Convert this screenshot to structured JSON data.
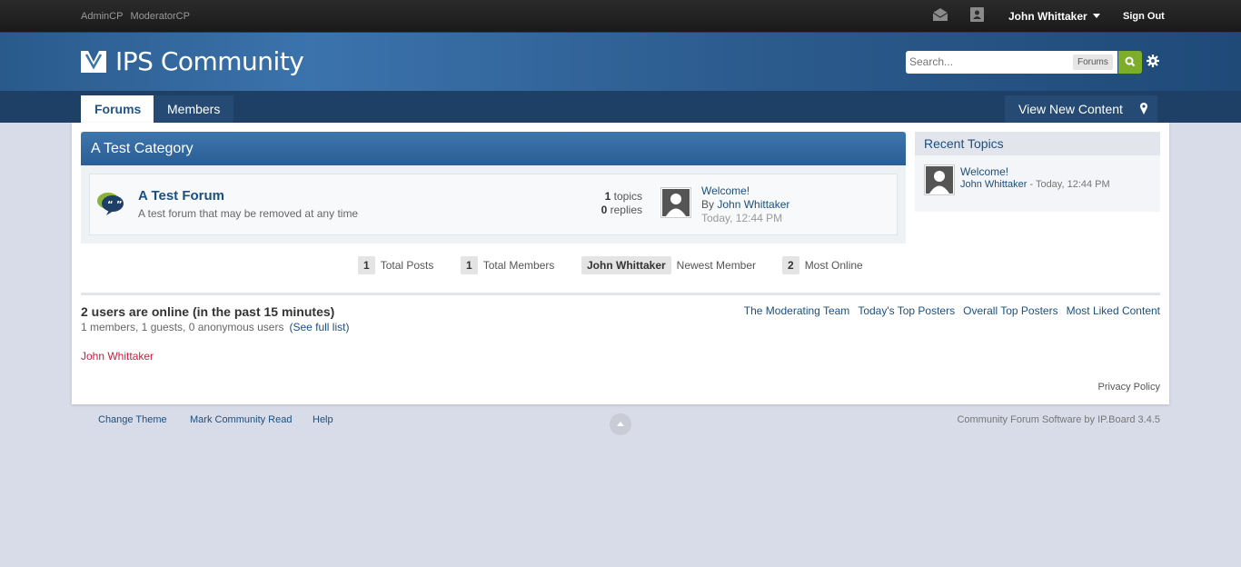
{
  "topbar": {
    "admin_links": [
      "AdminCP",
      "ModeratorCP"
    ],
    "user_name": "John Whittaker",
    "sign_out": "Sign Out",
    "icons": [
      "envelope-icon",
      "notifications-icon"
    ]
  },
  "header": {
    "logo_text": "IPS Community"
  },
  "search": {
    "placeholder": "Search...",
    "scope": "Forums"
  },
  "nav": {
    "tabs": [
      "Forums",
      "Members"
    ],
    "view_new": "View New Content"
  },
  "category": {
    "title": "A Test Category",
    "forum": {
      "title": "A Test Forum",
      "description": "A test forum that may be removed at any time",
      "topics_count": "1",
      "topics_label": "topics",
      "replies_count": "0",
      "replies_label": "replies",
      "last_post": {
        "title": "Welcome!",
        "by_label": "By",
        "author": "John Whittaker",
        "time": "Today, 12:44 PM"
      }
    }
  },
  "stats": {
    "total_posts": "1",
    "total_posts_label": "Total Posts",
    "total_members": "1",
    "total_members_label": "Total Members",
    "newest_member": "John Whittaker",
    "newest_member_label": "Newest Member",
    "most_online": "2",
    "most_online_label": "Most Online"
  },
  "online": {
    "title": "2 users are online (in the past 15 minutes)",
    "summary": "1 members, 1 guests, 0 anonymous users",
    "full_list": "(See full list)",
    "links": [
      "The Moderating Team",
      "Today's Top Posters",
      "Overall Top Posters",
      "Most Liked Content"
    ],
    "users": [
      "John Whittaker"
    ]
  },
  "privacy": "Privacy Policy",
  "sidebar": {
    "title": "Recent Topics",
    "topic": {
      "title": "Welcome!",
      "author": "John Whittaker",
      "time": " - Today, 12:44 PM"
    }
  },
  "footer": {
    "links": [
      "Change Theme",
      "Mark Community Read",
      "Help"
    ],
    "credit": "Community Forum Software by IP.Board 3.4.5"
  },
  "colors": {
    "accent": "#2b5e94",
    "search_button": "#7eac2b",
    "online_user": "#cc1f3c"
  }
}
